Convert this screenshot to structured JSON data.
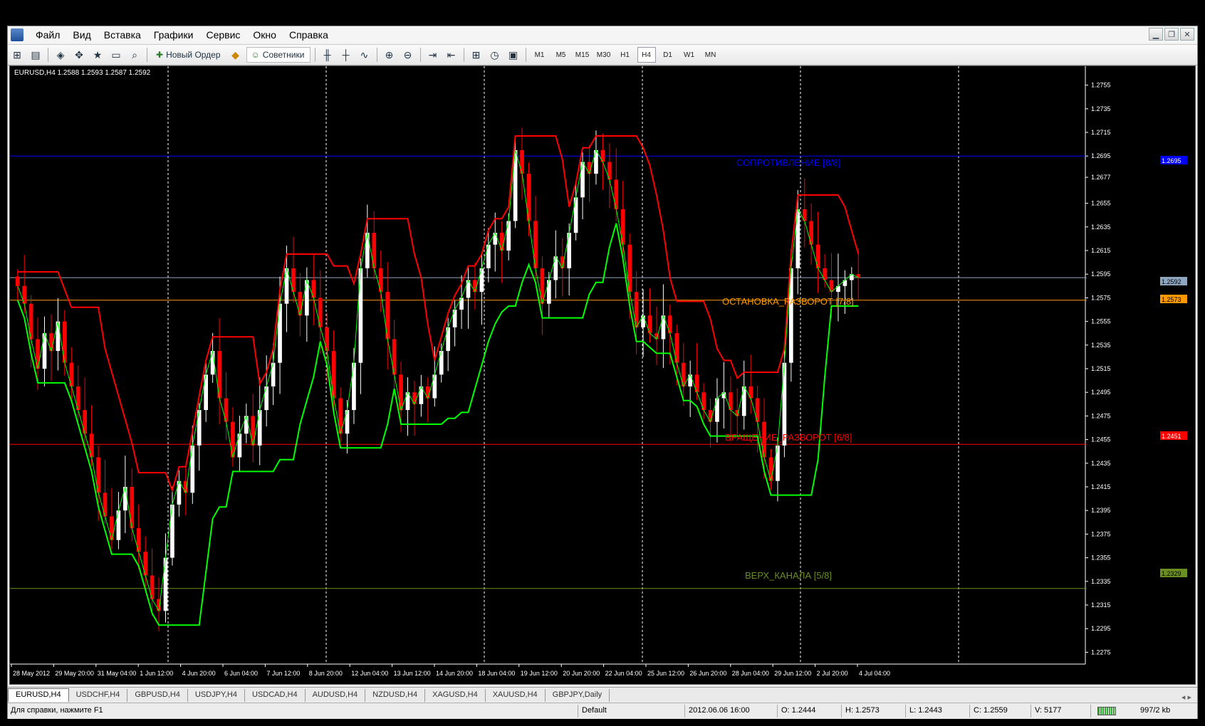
{
  "menu": [
    "Файл",
    "Вид",
    "Вставка",
    "Графики",
    "Сервис",
    "Окно",
    "Справка"
  ],
  "toolbar": {
    "new_order_label": "Новый Ордер",
    "experts_label": "Советники",
    "timeframes": [
      "M1",
      "M5",
      "M15",
      "M30",
      "H1",
      "H4",
      "D1",
      "W1",
      "MN"
    ],
    "active_timeframe": "H4"
  },
  "chart": {
    "header": "EURUSD,H4  1.2588 1.2593 1.2587 1.2592",
    "levels": {
      "resistance": "СОПРОТИВЛЕНИЕ [8/8]",
      "stop_reverse": "ОСТАНОВКА_РАЗВОРОТ [7/8]",
      "rotation": "ВРАЩЕНИЕ_РАЗВОРОТ [6/8]",
      "channel_top": "ВЕРХ_КАНАЛА [5/8]"
    },
    "price_badges": {
      "resistance": "1.2695",
      "current": "1.2592",
      "stop_reverse": "1.2573",
      "rotation": "1.2451",
      "channel_top": "1.2329"
    }
  },
  "chart_data": {
    "type": "candlestick",
    "symbol": "EURUSD",
    "timeframe": "H4",
    "ylim": [
      1.2265,
      1.2765
    ],
    "y_ticks": [
      "1.2755",
      "1.2735",
      "1.2715",
      "1.2695",
      "1.2677",
      "1.2655",
      "1.2635",
      "1.2615",
      "1.2595",
      "1.2575",
      "1.2555",
      "1.2535",
      "1.2515",
      "1.2495",
      "1.2475",
      "1.2455",
      "1.2435",
      "1.2415",
      "1.2395",
      "1.2375",
      "1.2355",
      "1.2335",
      "1.2315",
      "1.2295",
      "1.2275"
    ],
    "x_ticks": [
      "28 May 2012",
      "29 May 20:00",
      "31 May 04:00",
      "1 Jun 12:00",
      "4 Jun 20:00",
      "6 Jun 04:00",
      "7 Jun 12:00",
      "8 Jun 20:00",
      "12 Jun 04:00",
      "13 Jun 12:00",
      "14 Jun 20:00",
      "18 Jun 04:00",
      "19 Jun 12:00",
      "20 Jun 20:00",
      "22 Jun 04:00",
      "25 Jun 12:00",
      "26 Jun 20:00",
      "28 Jun 04:00",
      "29 Jun 12:00",
      "2 Jul 20:00",
      "4 Jul 04:00"
    ],
    "horizontal_levels": [
      {
        "name": "resistance",
        "value": 1.2695,
        "color": "#0000ff"
      },
      {
        "name": "current_price",
        "value": 1.2592,
        "color": "#8fa6c0"
      },
      {
        "name": "stop_reverse",
        "value": 1.2573,
        "color": "#ff9900"
      },
      {
        "name": "rotation",
        "value": 1.2451,
        "color": "#ff0000"
      },
      {
        "name": "channel_top",
        "value": 1.2329,
        "color": "#6b8e23"
      }
    ],
    "closes": [
      1.2585,
      1.257,
      1.254,
      1.2515,
      1.2545,
      1.253,
      1.2555,
      1.252,
      1.25,
      1.248,
      1.246,
      1.244,
      1.241,
      1.239,
      1.237,
      1.2395,
      1.2415,
      1.238,
      1.236,
      1.234,
      1.232,
      1.231,
      1.2355,
      1.24,
      1.242,
      1.241,
      1.245,
      1.248,
      1.251,
      1.253,
      1.249,
      1.247,
      1.244,
      1.246,
      1.2475,
      1.245,
      1.248,
      1.25,
      1.252,
      1.257,
      1.26,
      1.258,
      1.256,
      1.259,
      1.2575,
      1.255,
      1.253,
      1.249,
      1.246,
      1.248,
      1.252,
      1.26,
      1.263,
      1.26,
      1.258,
      1.254,
      1.251,
      1.248,
      1.2495,
      1.2485,
      1.25,
      1.249,
      1.251,
      1.253,
      1.255,
      1.2565,
      1.2575,
      1.259,
      1.258,
      1.26,
      1.262,
      1.263,
      1.2615,
      1.264,
      1.27,
      1.268,
      1.264,
      1.26,
      1.257,
      1.259,
      1.261,
      1.26,
      1.263,
      1.266,
      1.269,
      1.268,
      1.27,
      1.269,
      1.2675,
      1.265,
      1.262,
      1.258,
      1.255,
      1.256,
      1.2545,
      1.254,
      1.256,
      1.2545,
      1.252,
      1.25,
      1.251,
      1.2495,
      1.248,
      1.247,
      1.249,
      1.2495,
      1.248,
      1.2475,
      1.25,
      1.249,
      1.247,
      1.244,
      1.242,
      1.245,
      1.252,
      1.26,
      1.265,
      1.264,
      1.262,
      1.26,
      1.259,
      1.258,
      1.2585,
      1.259,
      1.2595,
      1.2592
    ],
    "series": [
      {
        "name": "red_channel",
        "color": "#ff0000"
      },
      {
        "name": "green_channel",
        "color": "#00ff00"
      }
    ]
  },
  "tabs": [
    "EURUSD,H4",
    "USDCHF,H4",
    "GBPUSD,H4",
    "USDJPY,H4",
    "USDCAD,H4",
    "AUDUSD,H4",
    "NZDUSD,H4",
    "XAGUSD,H4",
    "XAUUSD,H4",
    "GBPJPY,Daily"
  ],
  "status": {
    "help": "Для справки, нажмите F1",
    "profile": "Default",
    "datetime": "2012.06.06 16:00",
    "open": "O: 1.2444",
    "high": "H: 1.2573",
    "low": "L: 1.2443",
    "close": "C: 1.2559",
    "volume": "V: 5177",
    "traffic": "997/2 kb"
  },
  "colors": {
    "bull": "#ffffff",
    "bear": "#ff0000",
    "background": "#000000",
    "grid": "#ffffff"
  }
}
